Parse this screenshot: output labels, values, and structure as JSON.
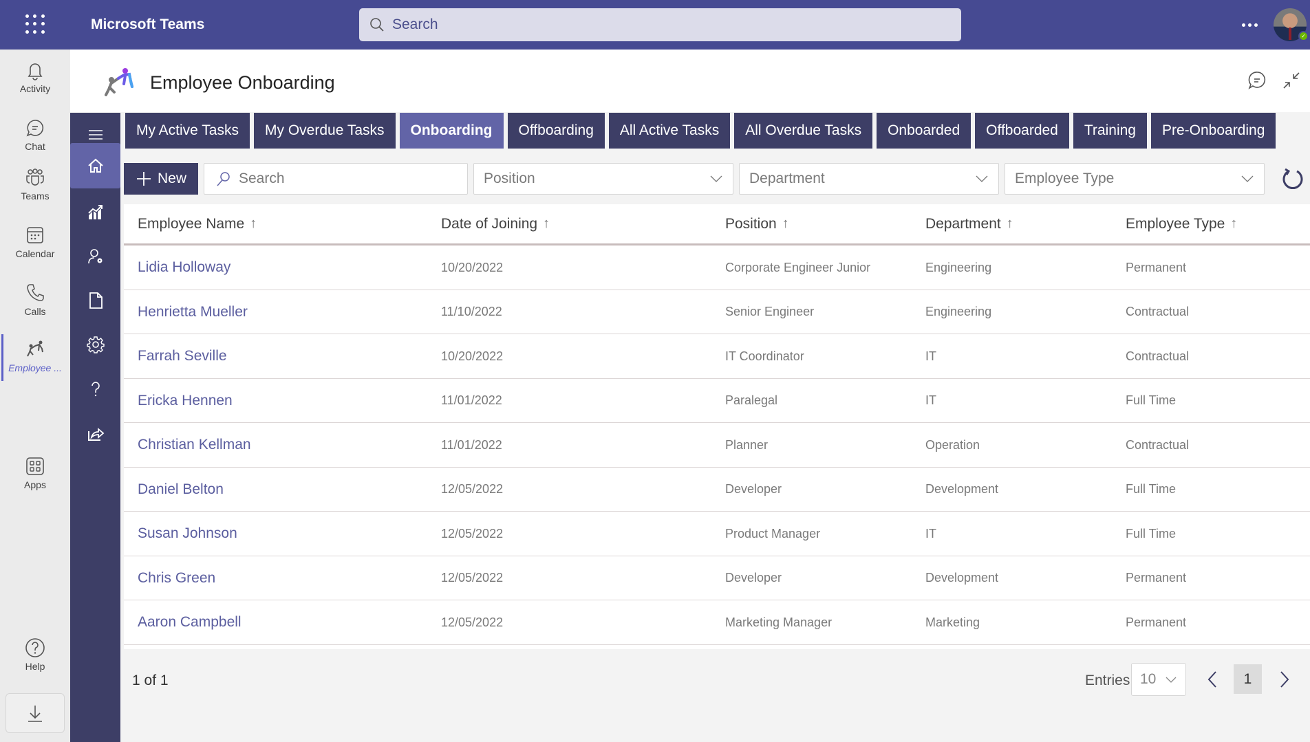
{
  "topbar": {
    "app_name": "Microsoft Teams",
    "search_placeholder": "Search",
    "more_icon": "ellipsis-icon",
    "presence_status": "Available"
  },
  "rail": {
    "items": [
      {
        "label": "Activity",
        "icon": "bell-icon"
      },
      {
        "label": "Chat",
        "icon": "chat-icon"
      },
      {
        "label": "Teams",
        "icon": "teams-icon"
      },
      {
        "label": "Calendar",
        "icon": "calendar-icon"
      },
      {
        "label": "Calls",
        "icon": "phone-icon"
      },
      {
        "label": "Employee ...",
        "icon": "employee-onboarding-icon",
        "active": true
      },
      {
        "label": "Apps",
        "icon": "apps-icon"
      },
      {
        "label": "Help",
        "icon": "help-icon"
      }
    ],
    "download_icon": "download-icon"
  },
  "app": {
    "title": "Employee Onboarding",
    "header_icons": [
      "chat-bubble-icon",
      "collapse-icon"
    ]
  },
  "inner_nav": {
    "items": [
      {
        "icon": "menu-icon"
      },
      {
        "icon": "home-icon",
        "active": true
      },
      {
        "icon": "analytics-icon"
      },
      {
        "icon": "user-settings-icon"
      },
      {
        "icon": "document-icon"
      },
      {
        "icon": "settings-icon"
      },
      {
        "icon": "question-icon"
      },
      {
        "icon": "share-icon"
      }
    ]
  },
  "tabs": [
    {
      "label": "My Active Tasks"
    },
    {
      "label": "My Overdue Tasks"
    },
    {
      "label": "Onboarding",
      "active": true
    },
    {
      "label": "Offboarding"
    },
    {
      "label": "All Active Tasks"
    },
    {
      "label": "All Overdue Tasks"
    },
    {
      "label": "Onboarded"
    },
    {
      "label": "Offboarded"
    },
    {
      "label": "Training"
    },
    {
      "label": "Pre-Onboarding"
    }
  ],
  "toolbar": {
    "new_label": "New",
    "search_placeholder": "Search",
    "position_placeholder": "Position",
    "department_placeholder": "Department",
    "employee_type_placeholder": "Employee Type"
  },
  "table": {
    "columns": [
      "Employee Name",
      "Date of Joining",
      "Position",
      "Department",
      "Employee Type"
    ],
    "sort_indicator": "↑",
    "rows": [
      {
        "name": "Lidia Holloway",
        "date": "10/20/2022",
        "position": "Corporate Engineer Junior",
        "department": "Engineering",
        "type": "Permanent"
      },
      {
        "name": "Henrietta Mueller",
        "date": "11/10/2022",
        "position": "Senior Engineer",
        "department": "Engineering",
        "type": "Contractual"
      },
      {
        "name": "Farrah Seville",
        "date": "10/20/2022",
        "position": "IT Coordinator",
        "department": "IT",
        "type": "Contractual"
      },
      {
        "name": "Ericka Hennen",
        "date": "11/01/2022",
        "position": "Paralegal",
        "department": "IT",
        "type": "Full Time"
      },
      {
        "name": "Christian Kellman",
        "date": "11/01/2022",
        "position": "Planner",
        "department": "Operation",
        "type": "Contractual"
      },
      {
        "name": "Daniel Belton",
        "date": "12/05/2022",
        "position": "Developer",
        "department": "Development",
        "type": "Full Time"
      },
      {
        "name": "Susan Johnson",
        "date": "12/05/2022",
        "position": "Product Manager",
        "department": "IT",
        "type": "Full Time"
      },
      {
        "name": "Chris Green",
        "date": "12/05/2022",
        "position": "Developer",
        "department": "Development",
        "type": "Permanent"
      },
      {
        "name": "Aaron Campbell",
        "date": "12/05/2022",
        "position": "Marketing Manager",
        "department": "Marketing",
        "type": "Permanent"
      }
    ]
  },
  "pagination": {
    "count_text": "1 of 1",
    "entries_label": "Entries",
    "entries_value": "10",
    "current_page": "1"
  },
  "colors": {
    "teams_header": "#464a92",
    "nav_dark": "#3d3e66",
    "accent": "#6264a7",
    "link": "#5b5e9f",
    "presence": "#6bb700"
  }
}
